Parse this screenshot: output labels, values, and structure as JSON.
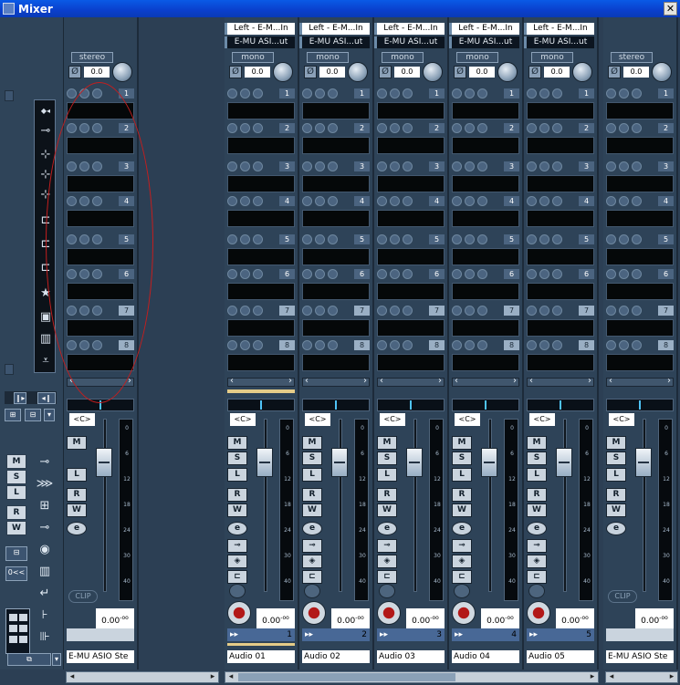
{
  "window": {
    "title": "Mixer",
    "close_glyph": "✕"
  },
  "input_strip": {
    "mode": "stereo",
    "gain": "0.0",
    "pan": "<C>",
    "volume": "0.00",
    "volume_exp": "-oo",
    "clip": "CLIP",
    "name": "E-MU ASIO Ste"
  },
  "output_strip": {
    "mode": "stereo",
    "gain": "0.0",
    "pan": "<C>",
    "volume": "0.00",
    "volume_exp": "-oo",
    "clip": "CLIP",
    "name": "E-MU ASIO Ste"
  },
  "slot_numbers": [
    "1",
    "2",
    "3",
    "4",
    "5",
    "6",
    "7",
    "8"
  ],
  "meter_scale": [
    "0",
    "6",
    "12",
    "18",
    "24",
    "30",
    "40"
  ],
  "button_labels": {
    "mute": "M",
    "solo": "S",
    "listen": "L",
    "read": "R",
    "write": "W",
    "edit": "e"
  },
  "channels": [
    {
      "input": "Left - E-M...In",
      "output": "E-MU ASI...ut",
      "mode": "mono",
      "gain": "0.0",
      "pan": "<C>",
      "volume": "0.00",
      "volume_exp": "-oo",
      "number": "1",
      "name": "Audio 01"
    },
    {
      "input": "Left - E-M...In",
      "output": "E-MU ASI...ut",
      "mode": "mono",
      "gain": "0.0",
      "pan": "<C>",
      "volume": "0.00",
      "volume_exp": "-oo",
      "number": "2",
      "name": "Audio 02"
    },
    {
      "input": "Left - E-M...In",
      "output": "E-MU ASI...ut",
      "mode": "mono",
      "gain": "0.0",
      "pan": "<C>",
      "volume": "0.00",
      "volume_exp": "-oo",
      "number": "3",
      "name": "Audio 03"
    },
    {
      "input": "Left - E-M...In",
      "output": "E-MU ASI...ut",
      "mode": "mono",
      "gain": "0.0",
      "pan": "<C>",
      "volume": "0.00",
      "volume_exp": "-oo",
      "number": "4",
      "name": "Audio 04"
    },
    {
      "input": "Left - E-M...In",
      "output": "E-MU ASI...ut",
      "mode": "mono",
      "gain": "0.0",
      "pan": "<C>",
      "volume": "0.00",
      "volume_exp": "-oo",
      "number": "5",
      "name": "Audio 05"
    }
  ],
  "left_panel": {
    "state_buttons": [
      "M",
      "S",
      "L",
      "R",
      "W"
    ],
    "reset_label": "0<<"
  }
}
